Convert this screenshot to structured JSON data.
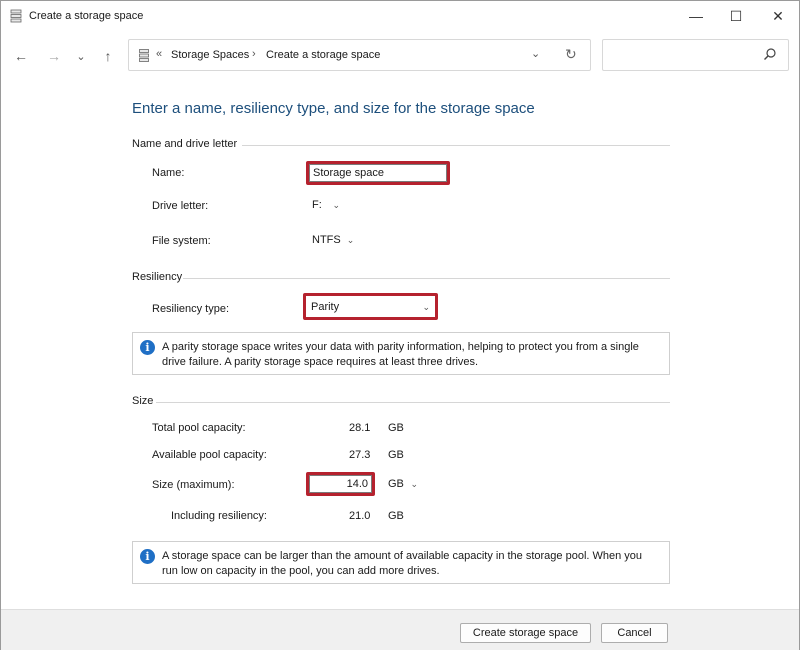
{
  "window": {
    "title": "Create a storage space",
    "min_symbol": "—",
    "max_symbol": "☐",
    "close_symbol": "✕"
  },
  "nav": {
    "back_symbol": "←",
    "forward_symbol": "→",
    "recent_symbol": "⌄",
    "up_symbol": "↑"
  },
  "address": {
    "overflow_symbol": "«",
    "breadcrumbs": [
      "Storage Spaces",
      "Create a storage space"
    ],
    "separator": "›",
    "dropdown_symbol": "⌄",
    "refresh_symbol": "↻"
  },
  "search": {
    "placeholder": ""
  },
  "heading": "Enter a name, resiliency type, and size for the storage space",
  "name_section": {
    "title": "Name and drive letter",
    "name_label": "Name:",
    "name_value": "Storage space",
    "drive_label": "Drive letter:",
    "drive_value": "F:",
    "fs_label": "File system:",
    "fs_value": "NTFS"
  },
  "resiliency_section": {
    "title": "Resiliency",
    "type_label": "Resiliency type:",
    "type_value": "Parity",
    "info": "A parity storage space writes your data with parity information, helping to protect you from a single drive failure. A parity storage space requires at least three drives."
  },
  "size_section": {
    "title": "Size",
    "total_label": "Total pool capacity:",
    "total_value": "28.1",
    "total_unit": "GB",
    "available_label": "Available pool capacity:",
    "available_value": "27.3",
    "available_unit": "GB",
    "size_label": "Size (maximum):",
    "size_value": "14.0",
    "size_unit": "GB",
    "resiliency_label": "Including resiliency:",
    "resiliency_value": "21.0",
    "resiliency_unit": "GB",
    "info": "A storage space can be larger than the amount of available capacity in the storage pool. When you run low on capacity in the pool, you can add more drives."
  },
  "footer": {
    "create_label": "Create storage space",
    "cancel_label": "Cancel"
  },
  "colors": {
    "heading": "#1d4f7c",
    "highlight": "#b5222e",
    "info_icon": "#1f6fc5"
  }
}
